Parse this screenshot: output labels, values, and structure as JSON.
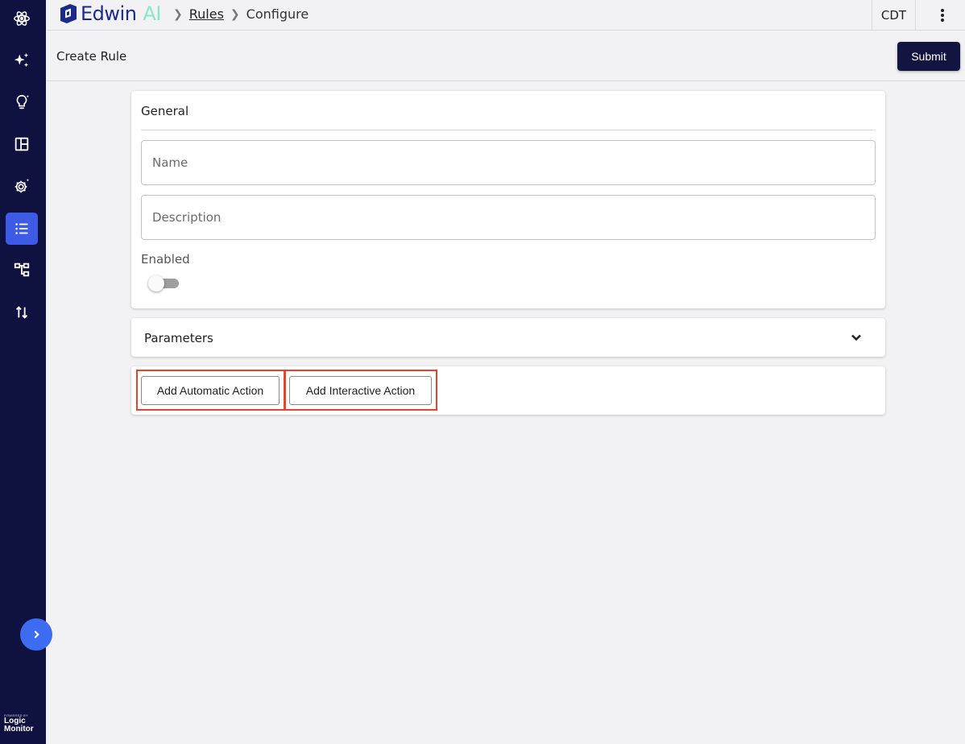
{
  "app": {
    "logo_name": "Edwin",
    "logo_suffix": "AI",
    "brand_footer_top": "POWERED BY",
    "brand_footer_line1": "Logic",
    "brand_footer_line2": "Monitor"
  },
  "breadcrumb": {
    "items": [
      "Rules",
      "Configure"
    ]
  },
  "topbar": {
    "timezone": "CDT"
  },
  "header": {
    "title": "Create Rule",
    "submit_label": "Submit"
  },
  "sidebar": {
    "items": [
      {
        "icon": "atom-icon",
        "active": false
      },
      {
        "icon": "sparkles-icon",
        "active": false
      },
      {
        "icon": "lightbulb-icon",
        "active": false
      },
      {
        "icon": "layout-panel-icon",
        "active": false
      },
      {
        "icon": "gear-sparkle-icon",
        "active": false
      },
      {
        "icon": "list-icon",
        "active": true
      },
      {
        "icon": "hierarchy-icon",
        "active": false
      },
      {
        "icon": "sort-arrows-icon",
        "active": false
      }
    ],
    "expand_icon": "chevron-right-icon"
  },
  "general": {
    "title": "General",
    "name_placeholder": "Name",
    "name_value": "",
    "description_placeholder": "Description",
    "description_value": "",
    "enabled_label": "Enabled",
    "enabled": false
  },
  "parameters": {
    "title": "Parameters",
    "expanded": false
  },
  "actions": {
    "automatic_label": "Add Automatic Action",
    "interactive_label": "Add Interactive Action"
  },
  "colors": {
    "sidebar_bg": "#0f1140",
    "active_nav": "#3e5be8",
    "submit_bg": "#121540",
    "highlight": "#e5452c",
    "logo_accent": "#8be6c6"
  }
}
